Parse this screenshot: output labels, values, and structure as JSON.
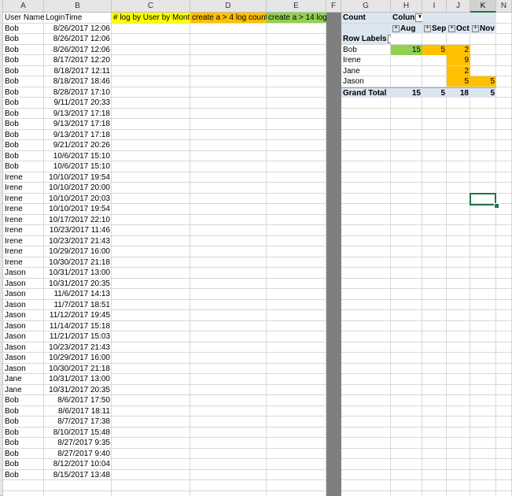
{
  "columns": [
    "A",
    "B",
    "C",
    "D",
    "E",
    "F",
    "G",
    "H",
    "I",
    "J",
    "K",
    "N"
  ],
  "headers": {
    "user_name": "User Name",
    "login_time": "LoginTime",
    "c": "# log by User by Month",
    "d": "create a  > 4 log count",
    "e": "create a > 14 log"
  },
  "rows": [
    [
      "Bob",
      "8/26/2017 12:06"
    ],
    [
      "Bob",
      "8/26/2017 12:06"
    ],
    [
      "Bob",
      "8/26/2017 12:06"
    ],
    [
      "Bob",
      "8/17/2017 12:20"
    ],
    [
      "Bob",
      "8/18/2017 12:11"
    ],
    [
      "Bob",
      "8/18/2017 18:46"
    ],
    [
      "Bob",
      "8/28/2017 17:10"
    ],
    [
      "Bob",
      "9/11/2017 20:33"
    ],
    [
      "Bob",
      "9/13/2017 17:18"
    ],
    [
      "Bob",
      "9/13/2017 17:18"
    ],
    [
      "Bob",
      "9/13/2017 17:18"
    ],
    [
      "Bob",
      "9/21/2017 20:26"
    ],
    [
      "Bob",
      "10/6/2017 15:10"
    ],
    [
      "Bob",
      "10/6/2017 15:10"
    ],
    [
      "Irene",
      "10/10/2017 19:54"
    ],
    [
      "Irene",
      "10/10/2017 20:00"
    ],
    [
      "Irene",
      "10/10/2017 20:03"
    ],
    [
      "Irene",
      "10/10/2017 19:54"
    ],
    [
      "Irene",
      "10/17/2017 22:10"
    ],
    [
      "Irene",
      "10/23/2017 11:46"
    ],
    [
      "Irene",
      "10/23/2017 21:43"
    ],
    [
      "Irene",
      "10/29/2017 16:00"
    ],
    [
      "Irene",
      "10/30/2017 21:18"
    ],
    [
      "Jason",
      "10/31/2017 13:00"
    ],
    [
      "Jason",
      "10/31/2017 20:35"
    ],
    [
      "Jason",
      "11/6/2017 14:13"
    ],
    [
      "Jason",
      "11/7/2017 18:51"
    ],
    [
      "Jason",
      "11/12/2017 19:45"
    ],
    [
      "Jason",
      "11/14/2017 15:18"
    ],
    [
      "Jason",
      "11/21/2017 15:03"
    ],
    [
      "Jason",
      "10/23/2017 21:43"
    ],
    [
      "Jason",
      "10/29/2017 16:00"
    ],
    [
      "Jason",
      "10/30/2017 21:18"
    ],
    [
      "Jane",
      "10/31/2017 13:00"
    ],
    [
      "Jane",
      "10/31/2017 20:35"
    ],
    [
      "Bob",
      "8/6/2017 17:50"
    ],
    [
      "Bob",
      "8/6/2017 18:11"
    ],
    [
      "Bob",
      "8/7/2017 17:38"
    ],
    [
      "Bob",
      "8/10/2017 15:48"
    ],
    [
      "Bob",
      "8/27/2017 9:35"
    ],
    [
      "Bob",
      "8/27/2017 9:40"
    ],
    [
      "Bob",
      "8/12/2017 10:04"
    ],
    [
      "Bob",
      "8/15/2017 13:48"
    ]
  ],
  "pivot": {
    "count_label": "Count",
    "col_labels_button": "Colun",
    "row_labels": "Row Labels",
    "months": [
      "Aug",
      "Sep",
      "Oct",
      "Nov"
    ],
    "names": [
      "Bob",
      "Irene",
      "Jane",
      "Jason"
    ],
    "values": [
      [
        "15",
        "5",
        "2",
        ""
      ],
      [
        "",
        "",
        "9",
        ""
      ],
      [
        "",
        "",
        "2",
        ""
      ],
      [
        "",
        "",
        "5",
        "5"
      ]
    ],
    "fills": [
      [
        "green",
        "orange",
        "orange",
        ""
      ],
      [
        "",
        "",
        "orange",
        ""
      ],
      [
        "",
        "",
        "orange",
        ""
      ],
      [
        "",
        "",
        "orange",
        "orange"
      ]
    ],
    "grand_total_label": "Grand Total",
    "totals": [
      "15",
      "5",
      "18",
      "5"
    ],
    "colors": {
      "header_fill": "#dce6f1",
      "green": "#92d050",
      "orange": "#ffc000",
      "yellow": "#ffff00",
      "hidden_col": "#7f7f7f",
      "selection": "#217346"
    },
    "icons": {
      "filter": "filter-dropdown-icon",
      "expand": "expand-plus-icon"
    }
  }
}
